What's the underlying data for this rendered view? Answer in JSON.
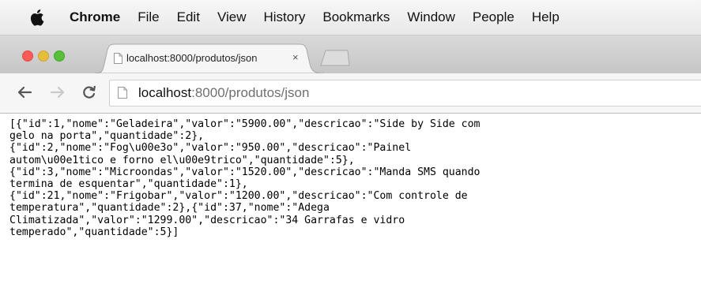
{
  "menubar": {
    "apple_icon": "apple-logo",
    "items": [
      "Chrome",
      "File",
      "Edit",
      "View",
      "History",
      "Bookmarks",
      "Window",
      "People",
      "Help"
    ]
  },
  "window": {
    "controls": {
      "close": "#fc5b57",
      "minimize": "#e5bf3c",
      "maximize": "#57c038"
    }
  },
  "tab": {
    "title": "localhost:8000/produtos/json",
    "close_glyph": "×",
    "favicon": "page-icon"
  },
  "toolbar": {
    "back_icon": "arrow-left-icon",
    "forward_icon": "arrow-right-icon",
    "reload_icon": "reload-icon",
    "url_host": "localhost",
    "url_path": ":8000/produtos/json"
  },
  "page": {
    "lines": [
      "[{\"id\":1,\"nome\":\"Geladeira\",\"valor\":\"5900.00\",\"descricao\":\"Side by Side com",
      "gelo na porta\",\"quantidade\":2},",
      "{\"id\":2,\"nome\":\"Fog\\u00e3o\",\"valor\":\"950.00\",\"descricao\":\"Painel",
      "autom\\u00e1tico e forno el\\u00e9trico\",\"quantidade\":5},",
      "{\"id\":3,\"nome\":\"Microondas\",\"valor\":\"1520.00\",\"descricao\":\"Manda SMS quando",
      "termina de esquentar\",\"quantidade\":1},",
      "{\"id\":21,\"nome\":\"Frigobar\",\"valor\":\"1200.00\",\"descricao\":\"Com controle de",
      "temperatura\",\"quantidade\":2},{\"id\":37,\"nome\":\"Adega",
      "Climatizada\",\"valor\":\"1299.00\",\"descricao\":\"34 Garrafas e vidro",
      "temperado\",\"quantidade\":5}]"
    ]
  }
}
